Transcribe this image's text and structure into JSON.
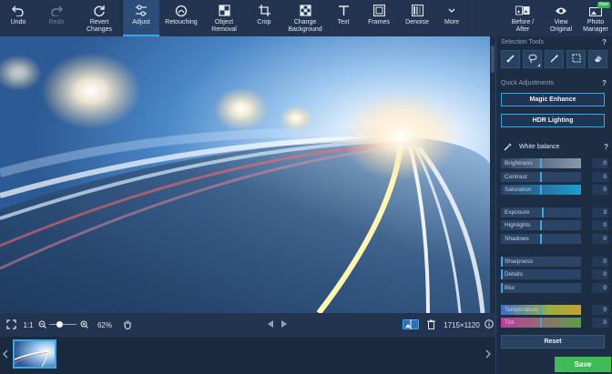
{
  "toolbar": {
    "undo": "Undo",
    "redo": "Redo",
    "revert": "Revert\nChanges",
    "adjust": "Adjust",
    "retouching": "Retouching",
    "object_removal": "Object\nRemoval",
    "crop": "Crop",
    "change_background": "Change\nBackground",
    "text": "Text",
    "frames": "Frames",
    "denoise": "Denoise",
    "more": "More",
    "before_after": "Before /\nAfter",
    "view_original": "View\nOriginal",
    "photo_manager": "Photo\nManager",
    "new_badge": "New"
  },
  "bottombar": {
    "fit_label": "1:1",
    "zoom": "62%",
    "zoom_fraction": 0.3,
    "dimensions": "1715×1120"
  },
  "panel": {
    "selection_tools_title": "Selection Tools",
    "quick_adjustments_title": "Quick Adjustments",
    "magic_enhance": "Magic Enhance",
    "hdr_lighting": "HDR Lighting",
    "white_balance": "White balance",
    "help": "?",
    "sliders": [
      {
        "label": "Brightness",
        "value": "0",
        "level": 0.5
      },
      {
        "label": "Contrast",
        "value": "0",
        "level": 0.5
      },
      {
        "label": "Saturation",
        "value": "0",
        "level": 0.5
      },
      {
        "label": "Exposure",
        "value": "3",
        "level": 0.52
      },
      {
        "label": "Highlights",
        "value": "0",
        "level": 0.5
      },
      {
        "label": "Shadows",
        "value": "0",
        "level": 0.5
      },
      {
        "label": "Sharpness",
        "value": "0",
        "level": 0.0
      },
      {
        "label": "Details",
        "value": "0",
        "level": 0.0
      },
      {
        "label": "Blur",
        "value": "0",
        "level": 0.0
      },
      {
        "label": "Temperature",
        "value": "0",
        "level": 0.5
      },
      {
        "label": "Tint",
        "value": "0",
        "level": 0.5
      }
    ],
    "reset": "Reset",
    "save": "Save"
  },
  "colors": {
    "accent": "#3aa7e8",
    "save": "#3fbb58"
  }
}
